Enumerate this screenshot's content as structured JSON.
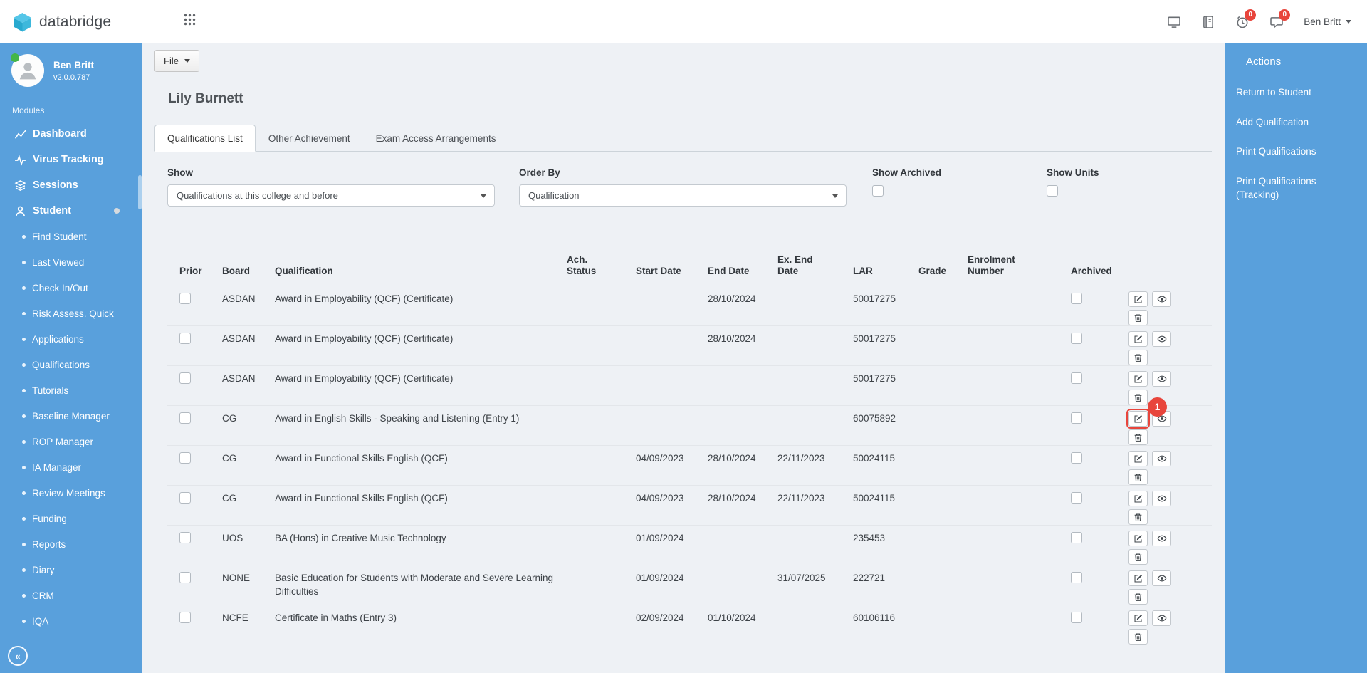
{
  "topbar": {
    "brand": "databridge",
    "user_name": "Ben Britt",
    "clock_badge": "0",
    "chat_badge": "0"
  },
  "sidebar": {
    "user_name": "Ben Britt",
    "user_version": "v2.0.0.787",
    "modules_label": "Modules",
    "items": [
      {
        "label": "Dashboard"
      },
      {
        "label": "Virus Tracking"
      },
      {
        "label": "Sessions"
      },
      {
        "label": "Student"
      }
    ],
    "subitems": [
      "Find Student",
      "Last Viewed",
      "Check In/Out",
      "Risk Assess. Quick",
      "Applications",
      "Qualifications",
      "Tutorials",
      "Baseline Manager",
      "ROP Manager",
      "IA Manager",
      "Review Meetings",
      "Funding",
      "Reports",
      "Diary",
      "CRM",
      "IQA"
    ]
  },
  "main": {
    "file_button_label": "File",
    "page_title": "Lily Burnett",
    "tabs": [
      {
        "label": "Qualifications List",
        "active": true
      },
      {
        "label": "Other Achievement",
        "active": false
      },
      {
        "label": "Exam Access Arrangements",
        "active": false
      }
    ],
    "filters": {
      "show_label": "Show",
      "show_value": "Qualifications at this college and before",
      "order_by_label": "Order By",
      "order_by_value": "Qualification",
      "show_archived_label": "Show Archived",
      "show_units_label": "Show Units"
    },
    "table": {
      "headers": [
        "Prior",
        "Board",
        "Qualification",
        "Ach. Status",
        "Start Date",
        "End Date",
        "Ex. End Date",
        "LAR",
        "Grade",
        "Enrolment Number",
        "Archived"
      ],
      "rows": [
        {
          "board": "ASDAN",
          "qualification": "Award in Employability (QCF) (Certificate)",
          "ach_status": "",
          "start_date": "",
          "end_date": "28/10/2024",
          "ex_end_date": "",
          "lar": "50017275",
          "grade": "",
          "enrolment_number": "",
          "annotated": false
        },
        {
          "board": "ASDAN",
          "qualification": "Award in Employability (QCF) (Certificate)",
          "ach_status": "",
          "start_date": "",
          "end_date": "28/10/2024",
          "ex_end_date": "",
          "lar": "50017275",
          "grade": "",
          "enrolment_number": "",
          "annotated": false
        },
        {
          "board": "ASDAN",
          "qualification": "Award in Employability (QCF) (Certificate)",
          "ach_status": "",
          "start_date": "",
          "end_date": "",
          "ex_end_date": "",
          "lar": "50017275",
          "grade": "",
          "enrolment_number": "",
          "annotated": false
        },
        {
          "board": "CG",
          "qualification": "Award in English Skills - Speaking and Listening (Entry 1)",
          "ach_status": "",
          "start_date": "",
          "end_date": "",
          "ex_end_date": "",
          "lar": "60075892",
          "grade": "",
          "enrolment_number": "",
          "annotated": true
        },
        {
          "board": "CG",
          "qualification": "Award in Functional Skills English (QCF)",
          "ach_status": "",
          "start_date": "04/09/2023",
          "end_date": "28/10/2024",
          "ex_end_date": "22/11/2023",
          "lar": "50024115",
          "grade": "",
          "enrolment_number": "",
          "annotated": false
        },
        {
          "board": "CG",
          "qualification": "Award in Functional Skills English (QCF)",
          "ach_status": "",
          "start_date": "04/09/2023",
          "end_date": "28/10/2024",
          "ex_end_date": "22/11/2023",
          "lar": "50024115",
          "grade": "",
          "enrolment_number": "",
          "annotated": false
        },
        {
          "board": "UOS",
          "qualification": "BA (Hons) in Creative Music Technology",
          "ach_status": "",
          "start_date": "01/09/2024",
          "end_date": "",
          "ex_end_date": "",
          "lar": "235453",
          "grade": "",
          "enrolment_number": "",
          "annotated": false
        },
        {
          "board": "NONE",
          "qualification": "Basic Education for Students with Moderate and Severe Learning Difficulties",
          "ach_status": "",
          "start_date": "01/09/2024",
          "end_date": "",
          "ex_end_date": "31/07/2025",
          "lar": "222721",
          "grade": "",
          "enrolment_number": "",
          "annotated": false
        },
        {
          "board": "NCFE",
          "qualification": "Certificate in Maths (Entry 3)",
          "ach_status": "",
          "start_date": "02/09/2024",
          "end_date": "01/10/2024",
          "ex_end_date": "",
          "lar": "60106116",
          "grade": "",
          "enrolment_number": "",
          "annotated": false
        }
      ]
    },
    "annotation_badge": "1"
  },
  "actions_panel": {
    "title": "Actions",
    "items": [
      "Return to Student",
      "Add Qualification",
      "Print Qualifications",
      "Print Qualifications (Tracking)"
    ]
  }
}
